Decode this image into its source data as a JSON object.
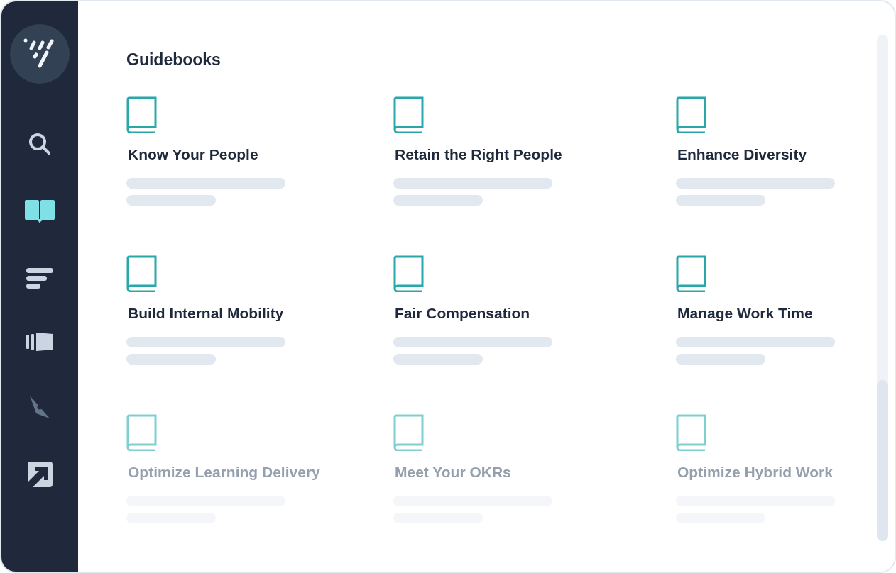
{
  "sidebar": {
    "items": [
      {
        "kind": "search",
        "selected": false
      },
      {
        "kind": "book",
        "selected": true
      },
      {
        "kind": "bars",
        "selected": false
      },
      {
        "kind": "stack",
        "selected": false
      },
      {
        "kind": "compass",
        "selected": false,
        "disabled": true
      },
      {
        "kind": "export",
        "selected": false
      }
    ]
  },
  "heading": "Guidebooks",
  "guidebooks": [
    {
      "title": "Know Your People",
      "faded": false
    },
    {
      "title": "Retain the Right People",
      "faded": false
    },
    {
      "title": "Enhance Diversity",
      "faded": false
    },
    {
      "title": "Build Internal Mobility",
      "faded": false
    },
    {
      "title": "Fair Compensation",
      "faded": false
    },
    {
      "title": "Manage Work Time",
      "faded": false
    },
    {
      "title": "Optimize Learning Delivery",
      "faded": true
    },
    {
      "title": "Meet Your OKRs",
      "faded": true
    },
    {
      "title": "Optimize Hybrid Work",
      "faded": true
    }
  ]
}
